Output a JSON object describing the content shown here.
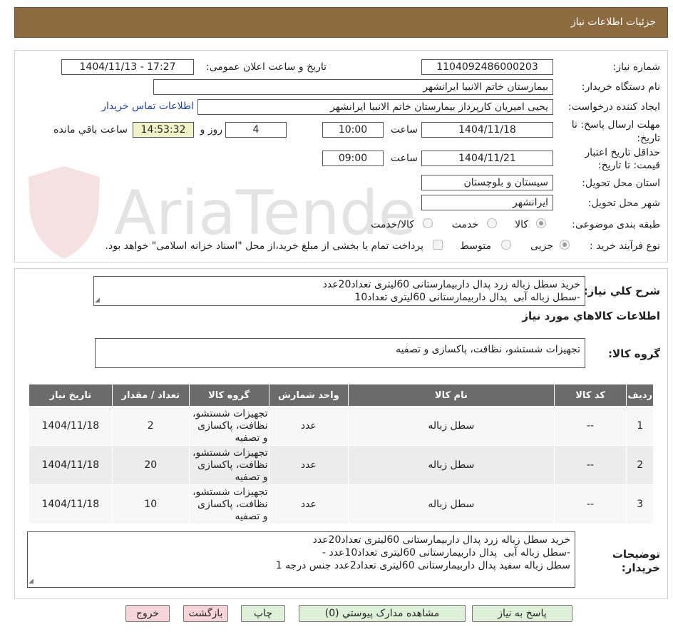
{
  "header": {
    "title": "جزئیات اطلاعات نیاز"
  },
  "watermark": {
    "text": "AriaTender.neT"
  },
  "form": {
    "need_number_label": "شماره نیاز:",
    "need_number": "1104092486000203",
    "announce_label": "تاریخ و ساعت اعلان عمومی:",
    "announce_value": "1404/11/13 - 17:27",
    "buyer_org_label": "نام دستگاه خریدار:",
    "buyer_org": "بیمارستان خاتم الانبیا ایرانشهر",
    "requester_label": "ایجاد کننده درخواست:",
    "requester": "یحیی امیریان کارپرداز بیمارستان خاتم الانبیا ایرانشهر",
    "contact_link": "اطلاعات تماس خریدار",
    "deadline_label_1": "مهلت ارسال پاسخ: تا",
    "deadline_label_2": "تاریخ:",
    "deadline_date": "1404/11/18",
    "time_word": "ساعت",
    "deadline_time": "10:00",
    "days_value": "4",
    "days_word": "روز و",
    "remaining_time": "14:53:32",
    "remaining_word": "ساعت باقي مانده",
    "validity_label_1": "حداقل تاریخ اعتبار",
    "validity_label_2": "قیمت: تا تاریخ:",
    "validity_date": "1404/11/21",
    "validity_time": "09:00",
    "province_label": "استان محل تحویل:",
    "province": "سیستان و بلوچستان",
    "city_label": "شهر محل تحویل:",
    "city": "ایرانشهر",
    "category_label": "طبقه بندی موضوعی:",
    "category_options": [
      "کالا",
      "خدمت",
      "کالا/خدمت"
    ],
    "process_label": "نوع فرآیند خرید :",
    "process_options": [
      "جزیی",
      "متوسط"
    ],
    "payment_note": "پرداخت تمام یا بخشی از مبلغ خرید،از محل \"اسناد خزانه اسلامی\" خواهد بود."
  },
  "summary": {
    "label": "شرح کلي نیاز:",
    "text": "خرید سطل زباله زرد پدال داربیمارستانی 60لیتری تعداد20عدد\n-سطل زباله آبی  پدال داربیمارستانی 60لیتری تعداد10",
    "goods_info_title": "اطلاعات کالاهاي مورد نیاز",
    "group_label": "گروه کالا:",
    "group_value": "تجهیزات شستشو، نظافت، پاکسازی و تصفیه"
  },
  "table": {
    "headers": [
      "ردیف",
      "کد کالا",
      "نام کالا",
      "واحد شمارش",
      "گروه کالا",
      "تعداد / مقدار",
      "تاریخ نیاز"
    ],
    "rows": [
      {
        "row": "1",
        "code": "--",
        "name": "سطل زباله",
        "unit": "عدد",
        "group": "تجهیزات شستشو، نظافت، پاکسازی و تصفیه",
        "qty": "2",
        "date": "1404/11/18"
      },
      {
        "row": "2",
        "code": "--",
        "name": "سطل زباله",
        "unit": "عدد",
        "group": "تجهیزات شستشو، نظافت، پاکسازی و تصفیه",
        "qty": "20",
        "date": "1404/11/18"
      },
      {
        "row": "3",
        "code": "--",
        "name": "سطل زباله",
        "unit": "عدد",
        "group": "تجهیزات شستشو، نظافت، پاکسازی و تصفیه",
        "qty": "10",
        "date": "1404/11/18"
      }
    ]
  },
  "notes": {
    "label_1": "توضیحات",
    "label_2": "خریدار:",
    "text": "خرید سطل زباله زرد پدال داربیمارستانی 60لیتری تعداد20عدد\n-سطل زباله آبی  پدال داربیمارستانی 60لیتری تعداد10عدد -\nسطل زباله سفید پدال داربیمارستانی 60لیتری تعداد2عدد جنس درجه 1"
  },
  "buttons": {
    "reply": "پاسخ به نیاز",
    "attachments": "مشاهده مدارک پیوستي (0)",
    "print": "چاپ",
    "back": "بازگشت",
    "exit": "خروج"
  },
  "colors": {
    "title_bar": "#8c6b40",
    "table_header": "#6b6b6b",
    "green_button": "#dff0d8",
    "pink_button": "#f7d4d8"
  }
}
